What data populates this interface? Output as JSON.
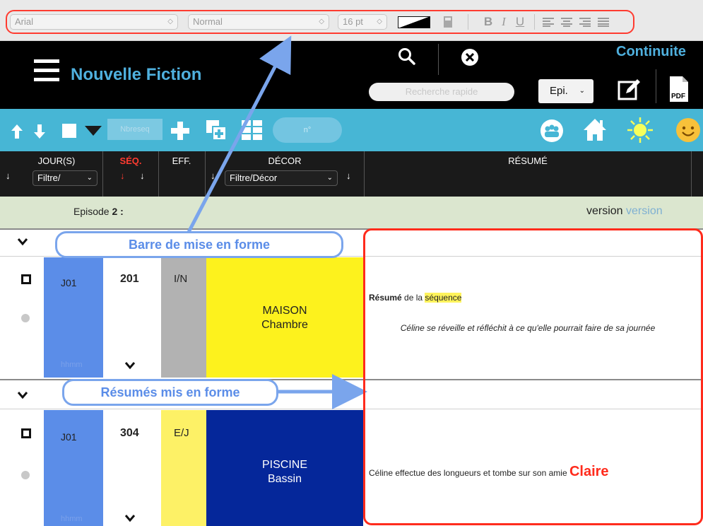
{
  "format_bar": {
    "font": "Arial",
    "style": "Normal",
    "size": "16 pt",
    "bold": "B",
    "italic": "I",
    "underline": "U"
  },
  "header": {
    "app_title": "Nouvelle Fiction",
    "right_title": "Continuite",
    "search_placeholder": "Recherche rapide",
    "epi_select": "Epi."
  },
  "toolbar": {
    "nbreseq_placeholder": "Nbreseq",
    "number_placeholder": "n°"
  },
  "columns": {
    "jours": "JOUR(S)",
    "jours_filter": "Filtre/",
    "seq": "SÉQ.",
    "eff": "EFF.",
    "decor": "DÉCOR",
    "decor_filter": "Filtre/Décor",
    "resume": "RÉSUMÉ"
  },
  "episode": {
    "label": "Episode",
    "number": "2 :",
    "version_label": "version",
    "version_value": "version"
  },
  "rows": [
    {
      "jour": "J01",
      "hhmm": "hhmm",
      "seq": "201",
      "eff": "I/N",
      "decor_main": "MAISON",
      "decor_sub": "Chambre",
      "resume_bold": "Résumé",
      "resume_mid": " de la ",
      "resume_highlight": "séquence",
      "resume_italic": "Céline se réveille et réfléchit à ce qu'elle pourrait faire de sa journée"
    },
    {
      "jour": "J01",
      "hhmm": "hhmm",
      "seq": "304",
      "eff": "E/J",
      "decor_main": "PISCINE",
      "decor_sub": "Bassin",
      "resume_text": "Céline effectue des longueurs et tombe sur son amie ",
      "resume_red": "Claire"
    }
  ],
  "annotations": {
    "callout_1": "Barre de mise en forme",
    "callout_2": "Résumés mis en forme"
  },
  "colors": {
    "accent_blue": "#4fb0de",
    "toolbar_blue": "#47b6d5",
    "annotation_blue": "#7aa5ec",
    "highlight_red": "#ff2b1c",
    "decor_yellow": "#fdf21d",
    "decor_blue": "#05279a",
    "jour_blue": "#5b8de8"
  }
}
